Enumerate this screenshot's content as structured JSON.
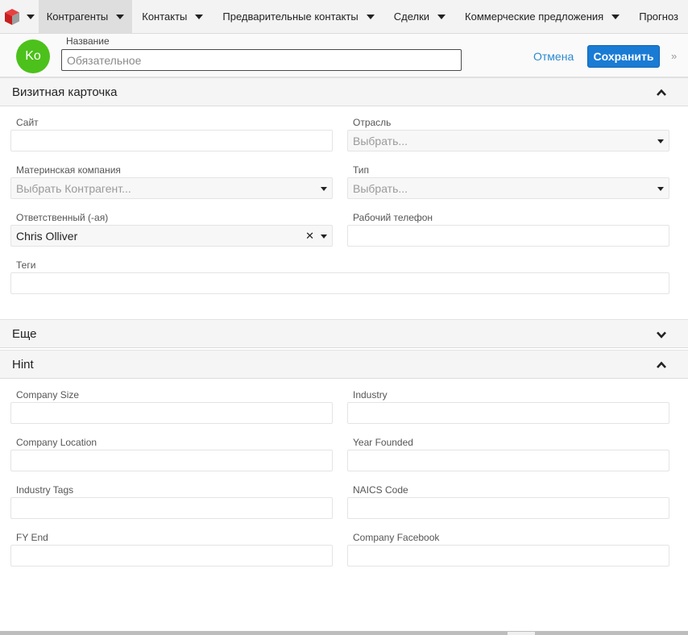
{
  "nav": {
    "items": [
      {
        "label": "Контрагенты",
        "active": true
      },
      {
        "label": "Контакты"
      },
      {
        "label": "Предварительные контакты"
      },
      {
        "label": "Сделки"
      },
      {
        "label": "Коммерческие предложения"
      },
      {
        "label": "Прогноз"
      }
    ]
  },
  "header": {
    "avatar_initials": "Ko",
    "name_label": "Название",
    "name_placeholder": "Обязательное",
    "cancel_label": "Отмена",
    "save_label": "Сохранить",
    "expand_icon": "»"
  },
  "business_card": {
    "title": "Визитная карточка",
    "fields": {
      "site": {
        "label": "Сайт",
        "value": ""
      },
      "industry": {
        "label": "Отрасль",
        "value": "Выбрать..."
      },
      "parent": {
        "label": "Материнская компания",
        "value": "Выбрать Контрагент..."
      },
      "type": {
        "label": "Тип",
        "value": "Выбрать..."
      },
      "assigned": {
        "label": "Ответственный (-ая)",
        "value": "Chris Olliver"
      },
      "work_phone": {
        "label": "Рабочий телефон",
        "value": ""
      },
      "tags": {
        "label": "Теги",
        "value": ""
      }
    }
  },
  "more": {
    "title": "Еще"
  },
  "hint": {
    "title": "Hint",
    "fields": {
      "company_size": {
        "label": "Company Size"
      },
      "industry": {
        "label": "Industry"
      },
      "company_location": {
        "label": "Company Location"
      },
      "year_founded": {
        "label": "Year Founded"
      },
      "industry_tags": {
        "label": "Industry Tags"
      },
      "naics_code": {
        "label": "NAICS Code"
      },
      "fy_end": {
        "label": "FY End"
      },
      "company_facebook": {
        "label": "Company Facebook"
      }
    }
  },
  "colors": {
    "accent": "#1a7bd5",
    "avatar": "#4cc11b",
    "link": "#2a8ad0"
  }
}
